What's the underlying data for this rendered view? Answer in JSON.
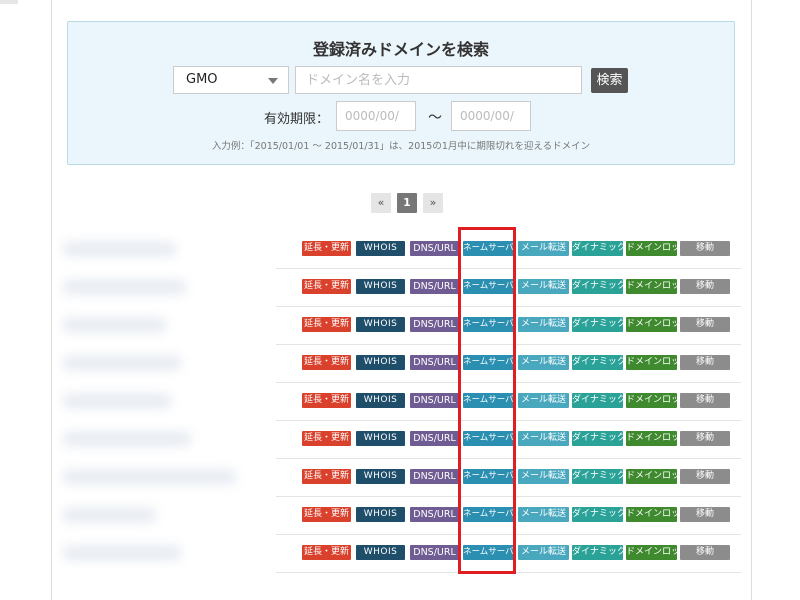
{
  "search": {
    "title": "登録済みドメインを検索",
    "registrar_selected": "GMO",
    "domain_placeholder": "ドメイン名を入力",
    "search_button": "検索",
    "expiry_label": "有効期限：",
    "date_from_placeholder": "0000/00/",
    "date_to_placeholder": "0000/00/",
    "range_separator": "～",
    "example": "入力例：「2015/01/01 ～ 2015/01/31」は、2015の1月中に期限切れを迎えるドメイン"
  },
  "pagination": {
    "prev": "«",
    "current": "1",
    "next": "»"
  },
  "actions": {
    "renew": "延長・更新",
    "whois": "WHOIS",
    "dns": "DNS/URL",
    "nameserver": "ネームサーバー",
    "mail": "メール転送",
    "dynamic": "ダイナミック",
    "lock": "ドメインロック",
    "move": "移動"
  },
  "rows": 9,
  "colors": {
    "renew": "#d9412d",
    "whois": "#1f4e6b",
    "dns": "#6f5c92",
    "nameserver": "#2a8fb0",
    "mail": "#4aa8be",
    "dynamic": "#2aa298",
    "lock": "#3f8a2f",
    "move": "#8c8c8c",
    "highlight": "#e11d24"
  }
}
